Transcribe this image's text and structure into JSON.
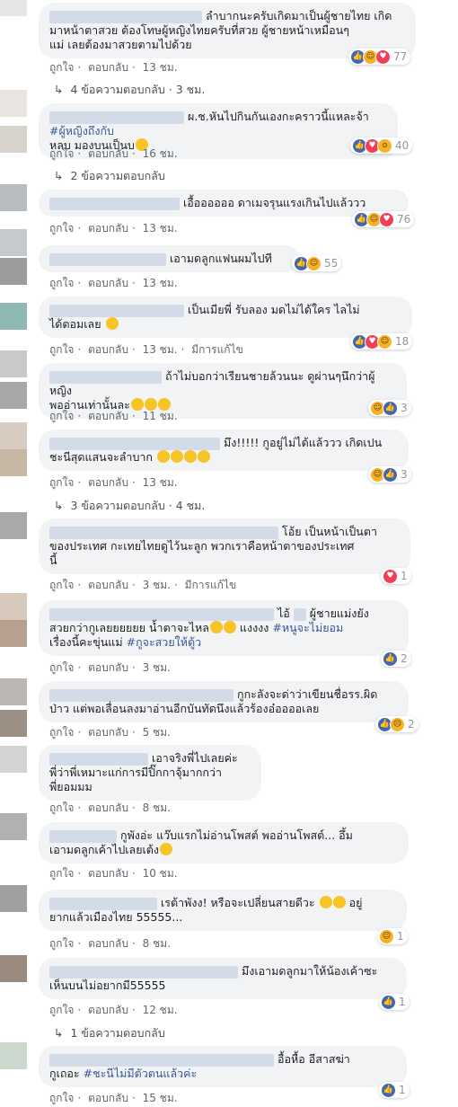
{
  "actions": {
    "like": "ถูกใจ",
    "reply": "ตอบกลับ",
    "edited": "มีการแก้ไข",
    "sep": "·"
  },
  "comments": [
    {
      "line1": "ลำบากนะครับเกิดมาเป็นผู้ชายไทย เกิด",
      "line2": "มาหน้าตาสวย ต้องโทษผู้หญิงไทยครับที่สวย ผู้ชายหน้าเหมือนๆ",
      "line3": "แม่ เลยต้องมาสวยตามไปด้วย",
      "time": "13 ชม.",
      "reactions": "77",
      "replies_label": "4 ข้อความตอบกลับ",
      "replies_time": "3 ชม."
    },
    {
      "line1": "ผ.ช.หันไปกินกันเองกะคราวนี้แหละจ้า",
      "tag": "#ผู้หญิงถึงกับ",
      "line2": "หลบ มองบนเป็นบ",
      "time": "16 ชม.",
      "reactions": "40",
      "replies_label": "2 ข้อความตอบกลับ"
    },
    {
      "line1": "เอื้ออออออ ดาเมจรุนแรงเกินไปแล้ววว",
      "time": "13 ชม.",
      "reactions": "76"
    },
    {
      "line1": "เอามดลูกแฟนผมไปที",
      "time": "13 ชม.",
      "reactions": "55"
    },
    {
      "line1": "เป็นเมียพี่ รับลอง มดไม่ได้ใคร ไลไม่",
      "line2": "ได้ตอมเลย",
      "time": "13 ชม.",
      "reactions": "18",
      "edited": true
    },
    {
      "line1": "ถ้าไม่บอกว่าเรียนชายล้วนนะ ดูผ่านๆนึกว่าผู้หญิง",
      "line2": "พออ่านเท่านั้นละ",
      "time": "11 ชม.",
      "reactions": "3"
    },
    {
      "line1": "มึง!!!!! กูอยู่ไม่ได้แล้ววว เกิดเปน",
      "line2": "ชะนีสุดแสนจะลำบาก",
      "time": "13 ชม.",
      "reactions": "3",
      "replies_label": "3 ข้อความตอบกลับ",
      "replies_time": "4 ชม."
    },
    {
      "line1": "โอ้ย เป็นหน้าเป็นตา",
      "line2": "ของประเทศ กะเทยไทยดูไว้นะลูก พวกเราคือหน้าตาของประเทศ",
      "line3": "นี้",
      "time": "3 ชม.",
      "reactions": "1",
      "edited": true
    },
    {
      "line1": "ไอ้",
      "line1b": "ผู้ชายแม่งยัง",
      "line2": "สวยกว่ากูเลยยยยยย น้ำตาจะไหล",
      "line2b": "แงงงง",
      "tag": "#หนูจะไม่ยอม",
      "line3": "เรื่องนี้คะขุ่นแม่",
      "tag3": "#กูจะสวยให้ตู้ว",
      "time": "3 ชม.",
      "reactions": "2"
    },
    {
      "line1": "กูกะลังจะด่าว่าเขียนชื่อรร.ผิด",
      "line2": "ป่าว แต่พอเลื่อนลงมาอ่านอีกบันทัดนึงแล้วร้องอ๋ออออเลย",
      "time": "5 ชม.",
      "reactions": "2"
    },
    {
      "line1": "เอาจริงพี่ไปเลยค่ะ",
      "line2": "พี่ว่าพี่เหมาะแก่การมีปิ๊กกาจุ้มากกว่า",
      "line3": "พี่ยอมมม",
      "time": "8 ชม."
    },
    {
      "line1": "กูพังอ่ะ แว๊บแรกไม่อ่านโพสต์ พออ่านโพสต์... อึ้ม",
      "line2": "เอามดลูกเค้าไปเลยเต้ง",
      "time": "10 ชม."
    },
    {
      "line1": "เรต้าพังง! หรือจะเปลี่ยนสายดีวะ",
      "line1b": "อยู่",
      "line2": "ยากแล้วเมืองไทย 55555...",
      "time": "8 ชม.",
      "reactions": "1"
    },
    {
      "line1": "มึงเอามดลูกมาให้น้องเค้าซะ",
      "line2": "เห็นบนไม่อยากมี55555",
      "time": "12 ชม.",
      "reactions": "1",
      "replies_label": "1 ข้อความตอบกลับ"
    },
    {
      "line1": "อื้อหื้อ อีสาสฆ่า",
      "line2": "กูเถอะ",
      "tag": "#ชะนีไม่มีตัวตนแล้วค่ะ",
      "time": "15 ชม.",
      "reactions": "1"
    }
  ]
}
